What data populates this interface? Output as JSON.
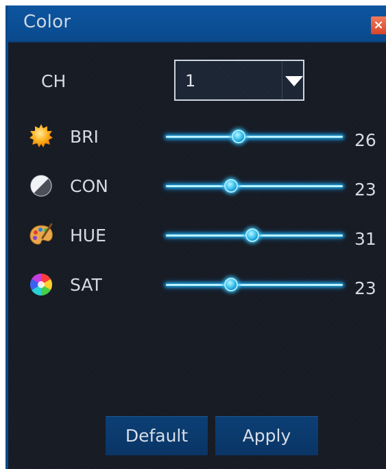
{
  "window": {
    "title": "Color",
    "close_label": "×"
  },
  "channel": {
    "label": "CH",
    "value": "1"
  },
  "rows": [
    {
      "label": "BRI",
      "value": "26",
      "level": 0.41,
      "icon": "sun-icon"
    },
    {
      "label": "CON",
      "value": "23",
      "level": 0.37,
      "icon": "contrast-icon"
    },
    {
      "label": "HUE",
      "value": "31",
      "level": 0.49,
      "icon": "palette-icon"
    },
    {
      "label": "SAT",
      "value": "23",
      "level": 0.37,
      "icon": "color-wheel-icon"
    }
  ],
  "buttons": {
    "default_label": "Default",
    "apply_label": "Apply"
  },
  "colors": {
    "title_bar": "#0a4a8c",
    "background": "#151922",
    "slider_glow": "#31b7ea",
    "close_button": "#e05a3c"
  }
}
